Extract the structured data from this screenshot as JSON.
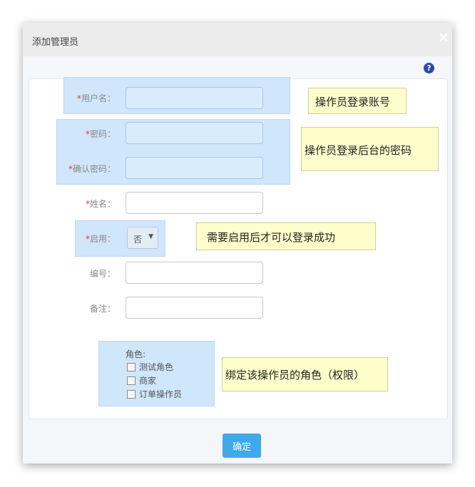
{
  "dialog": {
    "title": "添加管理员",
    "close_icon": "×",
    "help_icon": "?"
  },
  "form": {
    "username": {
      "label": "用户名：",
      "value": ""
    },
    "password": {
      "label": "密码：",
      "value": ""
    },
    "confirm_password": {
      "label": "确认密码：",
      "value": ""
    },
    "name": {
      "label": "姓名：",
      "value": ""
    },
    "enabled": {
      "label": "启用：",
      "selected": "否"
    },
    "number": {
      "label": "编号：",
      "value": ""
    },
    "remark": {
      "label": "备注：",
      "value": ""
    },
    "required_mark": "*",
    "roles_title": "角色:",
    "roles": [
      {
        "label": "测试角色",
        "checked": false
      },
      {
        "label": "商家",
        "checked": false
      },
      {
        "label": "订单操作员",
        "checked": false
      }
    ],
    "submit_label": "确定"
  },
  "notes": {
    "username": "操作员登录账号",
    "password": "操作员登录后台的密码",
    "enabled": "需要启用后才可以登录成功",
    "roles": "绑定该操作员的角色（权限）"
  },
  "colors": {
    "accent": "#3fa9ea",
    "highlight": "#cfe6fb",
    "note_bg": "#ffffcc",
    "required": "#e53935"
  }
}
